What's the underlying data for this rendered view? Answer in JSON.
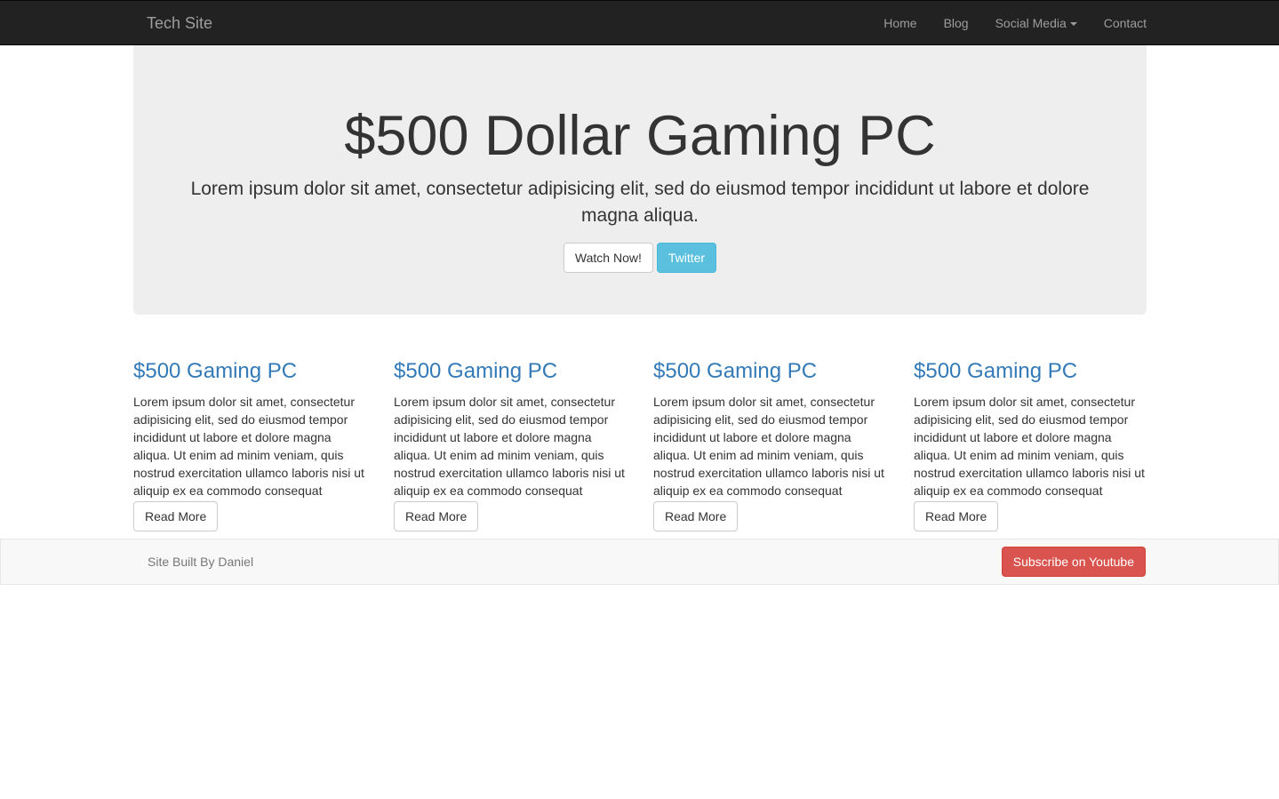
{
  "navbar": {
    "brand": "Tech Site",
    "items": [
      {
        "label": "Home"
      },
      {
        "label": "Blog"
      },
      {
        "label": "Social Media"
      },
      {
        "label": "Contact"
      }
    ]
  },
  "jumbotron": {
    "title": "$500 Dollar Gaming PC",
    "lead": "Lorem ipsum dolor sit amet, consectetur adipisicing elit, sed do eiusmod tempor incididunt ut labore et dolore magna aliqua.",
    "primary_button": "Watch Now!",
    "secondary_button": "Twitter"
  },
  "columns": [
    {
      "heading": "$500 Gaming PC",
      "body": "Lorem ipsum dolor sit amet, consectetur adipisicing elit, sed do eiusmod tempor incididunt ut labore et dolore magna aliqua. Ut enim ad minim veniam, quis nostrud exercitation ullamco laboris nisi ut aliquip ex ea commodo consequat",
      "button": "Read More"
    },
    {
      "heading": "$500 Gaming PC",
      "body": "Lorem ipsum dolor sit amet, consectetur adipisicing elit, sed do eiusmod tempor incididunt ut labore et dolore magna aliqua. Ut enim ad minim veniam, quis nostrud exercitation ullamco laboris nisi ut aliquip ex ea commodo consequat",
      "button": "Read More"
    },
    {
      "heading": "$500 Gaming PC",
      "body": "Lorem ipsum dolor sit amet, consectetur adipisicing elit, sed do eiusmod tempor incididunt ut labore et dolore magna aliqua. Ut enim ad minim veniam, quis nostrud exercitation ullamco laboris nisi ut aliquip ex ea commodo consequat",
      "button": "Read More"
    },
    {
      "heading": "$500 Gaming PC",
      "body": "Lorem ipsum dolor sit amet, consectetur adipisicing elit, sed do eiusmod tempor incididunt ut labore et dolore magna aliqua. Ut enim ad minim veniam, quis nostrud exercitation ullamco laboris nisi ut aliquip ex ea commodo consequat",
      "button": "Read More"
    }
  ],
  "footer": {
    "credit": "Site Built By Daniel",
    "subscribe_button": "Subscribe on Youtube"
  },
  "colors": {
    "navbar_bg": "#222222",
    "jumbotron_bg": "#eeeeee",
    "link_blue": "#337ab7",
    "info": "#5bc0de",
    "danger": "#d9534f"
  }
}
